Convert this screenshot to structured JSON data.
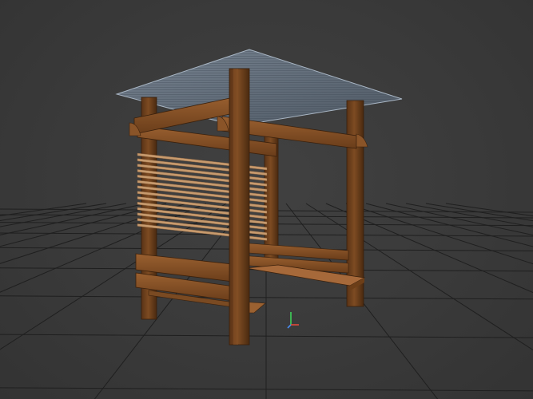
{
  "viewport": {
    "background": "#3b3b3b",
    "grid_color": "#1f1f1f"
  },
  "model": {
    "subject": "wooden-pergola",
    "wood_color": "#7a4a22",
    "wood_dark": "#4f2d12",
    "wood_light": "#a0652f",
    "slat_color": "#c79a6d",
    "roof_color": "#6e7c8c"
  },
  "gizmo": {
    "x_color": "#e24a3b",
    "y_color": "#3ed35a",
    "z_color": "#4a8df0"
  }
}
